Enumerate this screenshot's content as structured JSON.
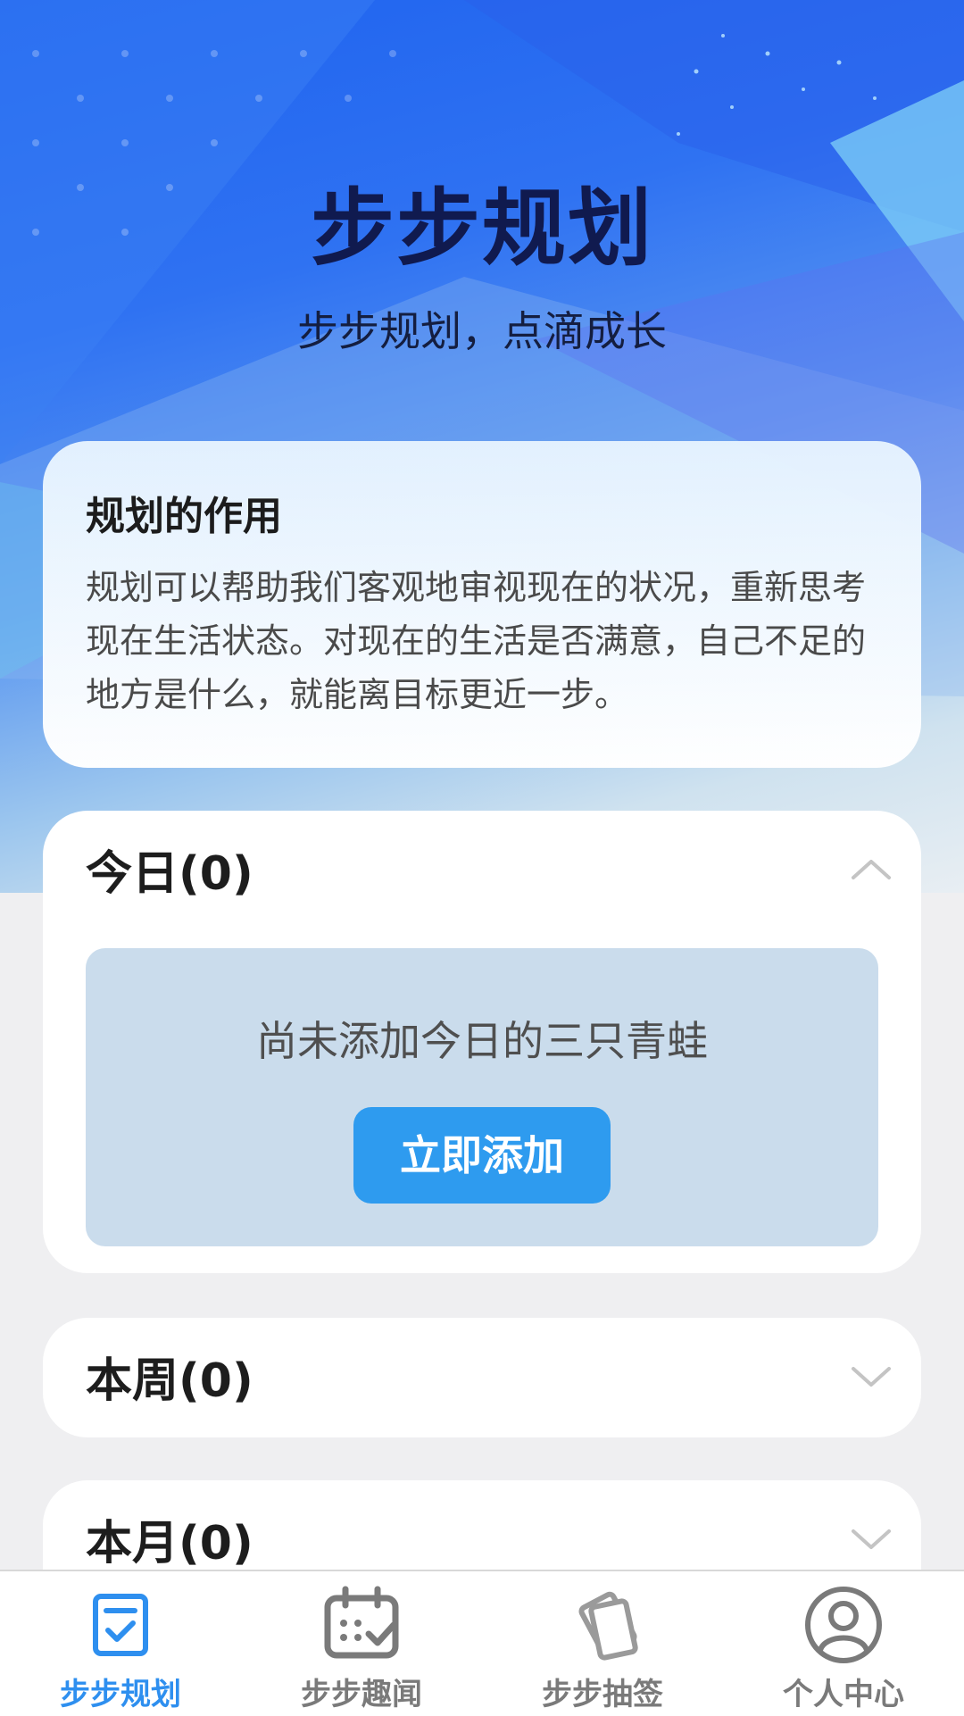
{
  "hero": {
    "title": "步步规划",
    "subtitle": "步步规划，点滴成长"
  },
  "info_card": {
    "title": "规划的作用",
    "body": "规划可以帮助我们客观地审视现在的状况，重新思考现在生活状态。对现在的生活是否满意，自己不足的地方是什么，就能离目标更近一步。"
  },
  "sections": {
    "today": {
      "title": "今日(0)",
      "expanded": true,
      "empty_text": "尚未添加今日的三只青蛙",
      "add_label": "立即添加"
    },
    "week": {
      "title": "本周(0)",
      "expanded": false
    },
    "month": {
      "title": "本月(0)",
      "expanded": false
    }
  },
  "tabbar": {
    "items": [
      {
        "label": "步步规划",
        "icon": "checklist-icon",
        "active": true
      },
      {
        "label": "步步趣闻",
        "icon": "calendar-check-icon",
        "active": false
      },
      {
        "label": "步步抽签",
        "icon": "cards-icon",
        "active": false
      },
      {
        "label": "个人中心",
        "icon": "user-icon",
        "active": false
      }
    ]
  },
  "colors": {
    "accent": "#2e9bef",
    "active_tab": "#2e8fef",
    "inactive_tab": "#7a7a7a",
    "empty_box": "#cadcec"
  }
}
